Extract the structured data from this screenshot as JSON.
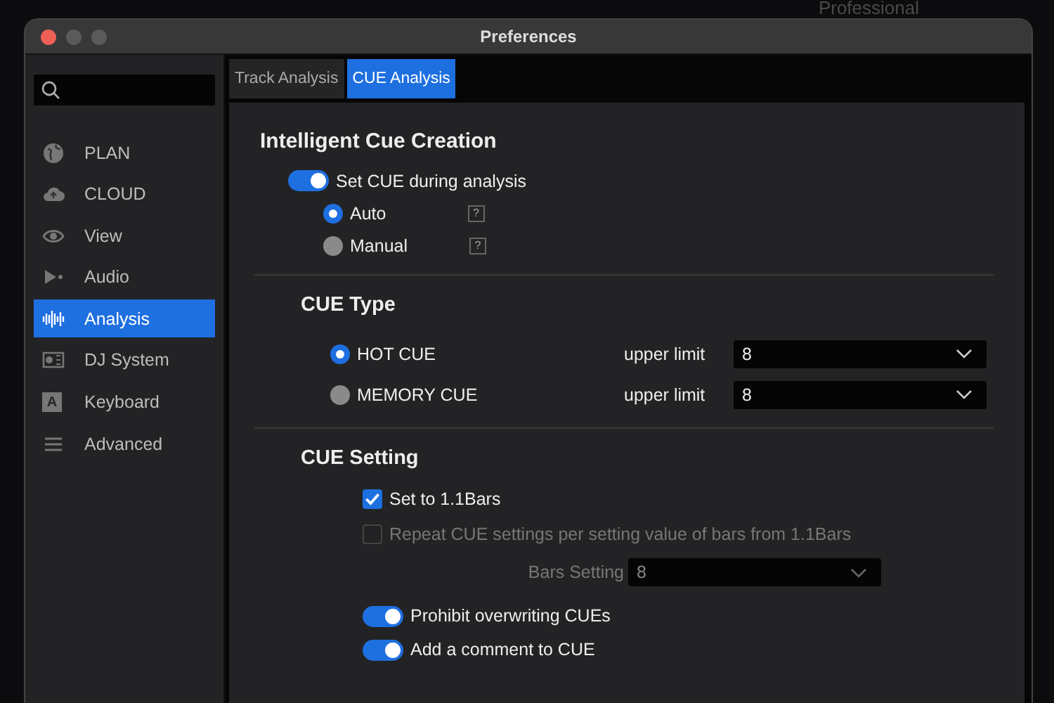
{
  "background_app": {
    "label": "Professional"
  },
  "window": {
    "title": "Preferences"
  },
  "sidebar": {
    "items": [
      {
        "label": "PLAN",
        "selected": false
      },
      {
        "label": "CLOUD",
        "selected": false
      },
      {
        "label": "View",
        "selected": false
      },
      {
        "label": "Audio",
        "selected": false
      },
      {
        "label": "Analysis",
        "selected": true
      },
      {
        "label": "DJ System",
        "selected": false
      },
      {
        "label": "Keyboard",
        "icon_text": "A",
        "selected": false
      },
      {
        "label": "Advanced",
        "selected": false
      }
    ]
  },
  "tabs": [
    {
      "label": "Track Analysis",
      "selected": false
    },
    {
      "label": "CUE Analysis",
      "selected": true
    }
  ],
  "sections": [
    {
      "title": "Intelligent Cue Creation",
      "rows": [
        {
          "kind": "toggle",
          "label": "Set CUE during analysis",
          "on": true
        },
        {
          "kind": "radio",
          "label": "Auto",
          "selected": true,
          "help": "?"
        },
        {
          "kind": "radio",
          "label": "Manual",
          "selected": false,
          "help": "?"
        }
      ]
    },
    {
      "title": "CUE Type",
      "rows": [
        {
          "kind": "radio_select",
          "label": "HOT CUE",
          "selected": true,
          "field_label": "upper limit",
          "value": "8"
        },
        {
          "kind": "radio_select",
          "label": "MEMORY CUE",
          "selected": false,
          "field_label": "upper limit",
          "value": "8"
        }
      ]
    },
    {
      "title": "CUE Setting",
      "rows": [
        {
          "kind": "checkbox",
          "label": "Set to 1.1Bars",
          "checked": true,
          "disabled": false
        },
        {
          "kind": "checkbox",
          "label": "Repeat CUE settings per setting value of bars from 1.1Bars",
          "checked": false,
          "disabled": true
        },
        {
          "kind": "select",
          "label": "Bars Setting",
          "value": "8",
          "disabled": true
        },
        {
          "kind": "toggle",
          "label": "Prohibit overwriting CUEs",
          "on": true
        },
        {
          "kind": "toggle",
          "label": "Add a comment to CUE",
          "on": true
        }
      ]
    }
  ]
}
